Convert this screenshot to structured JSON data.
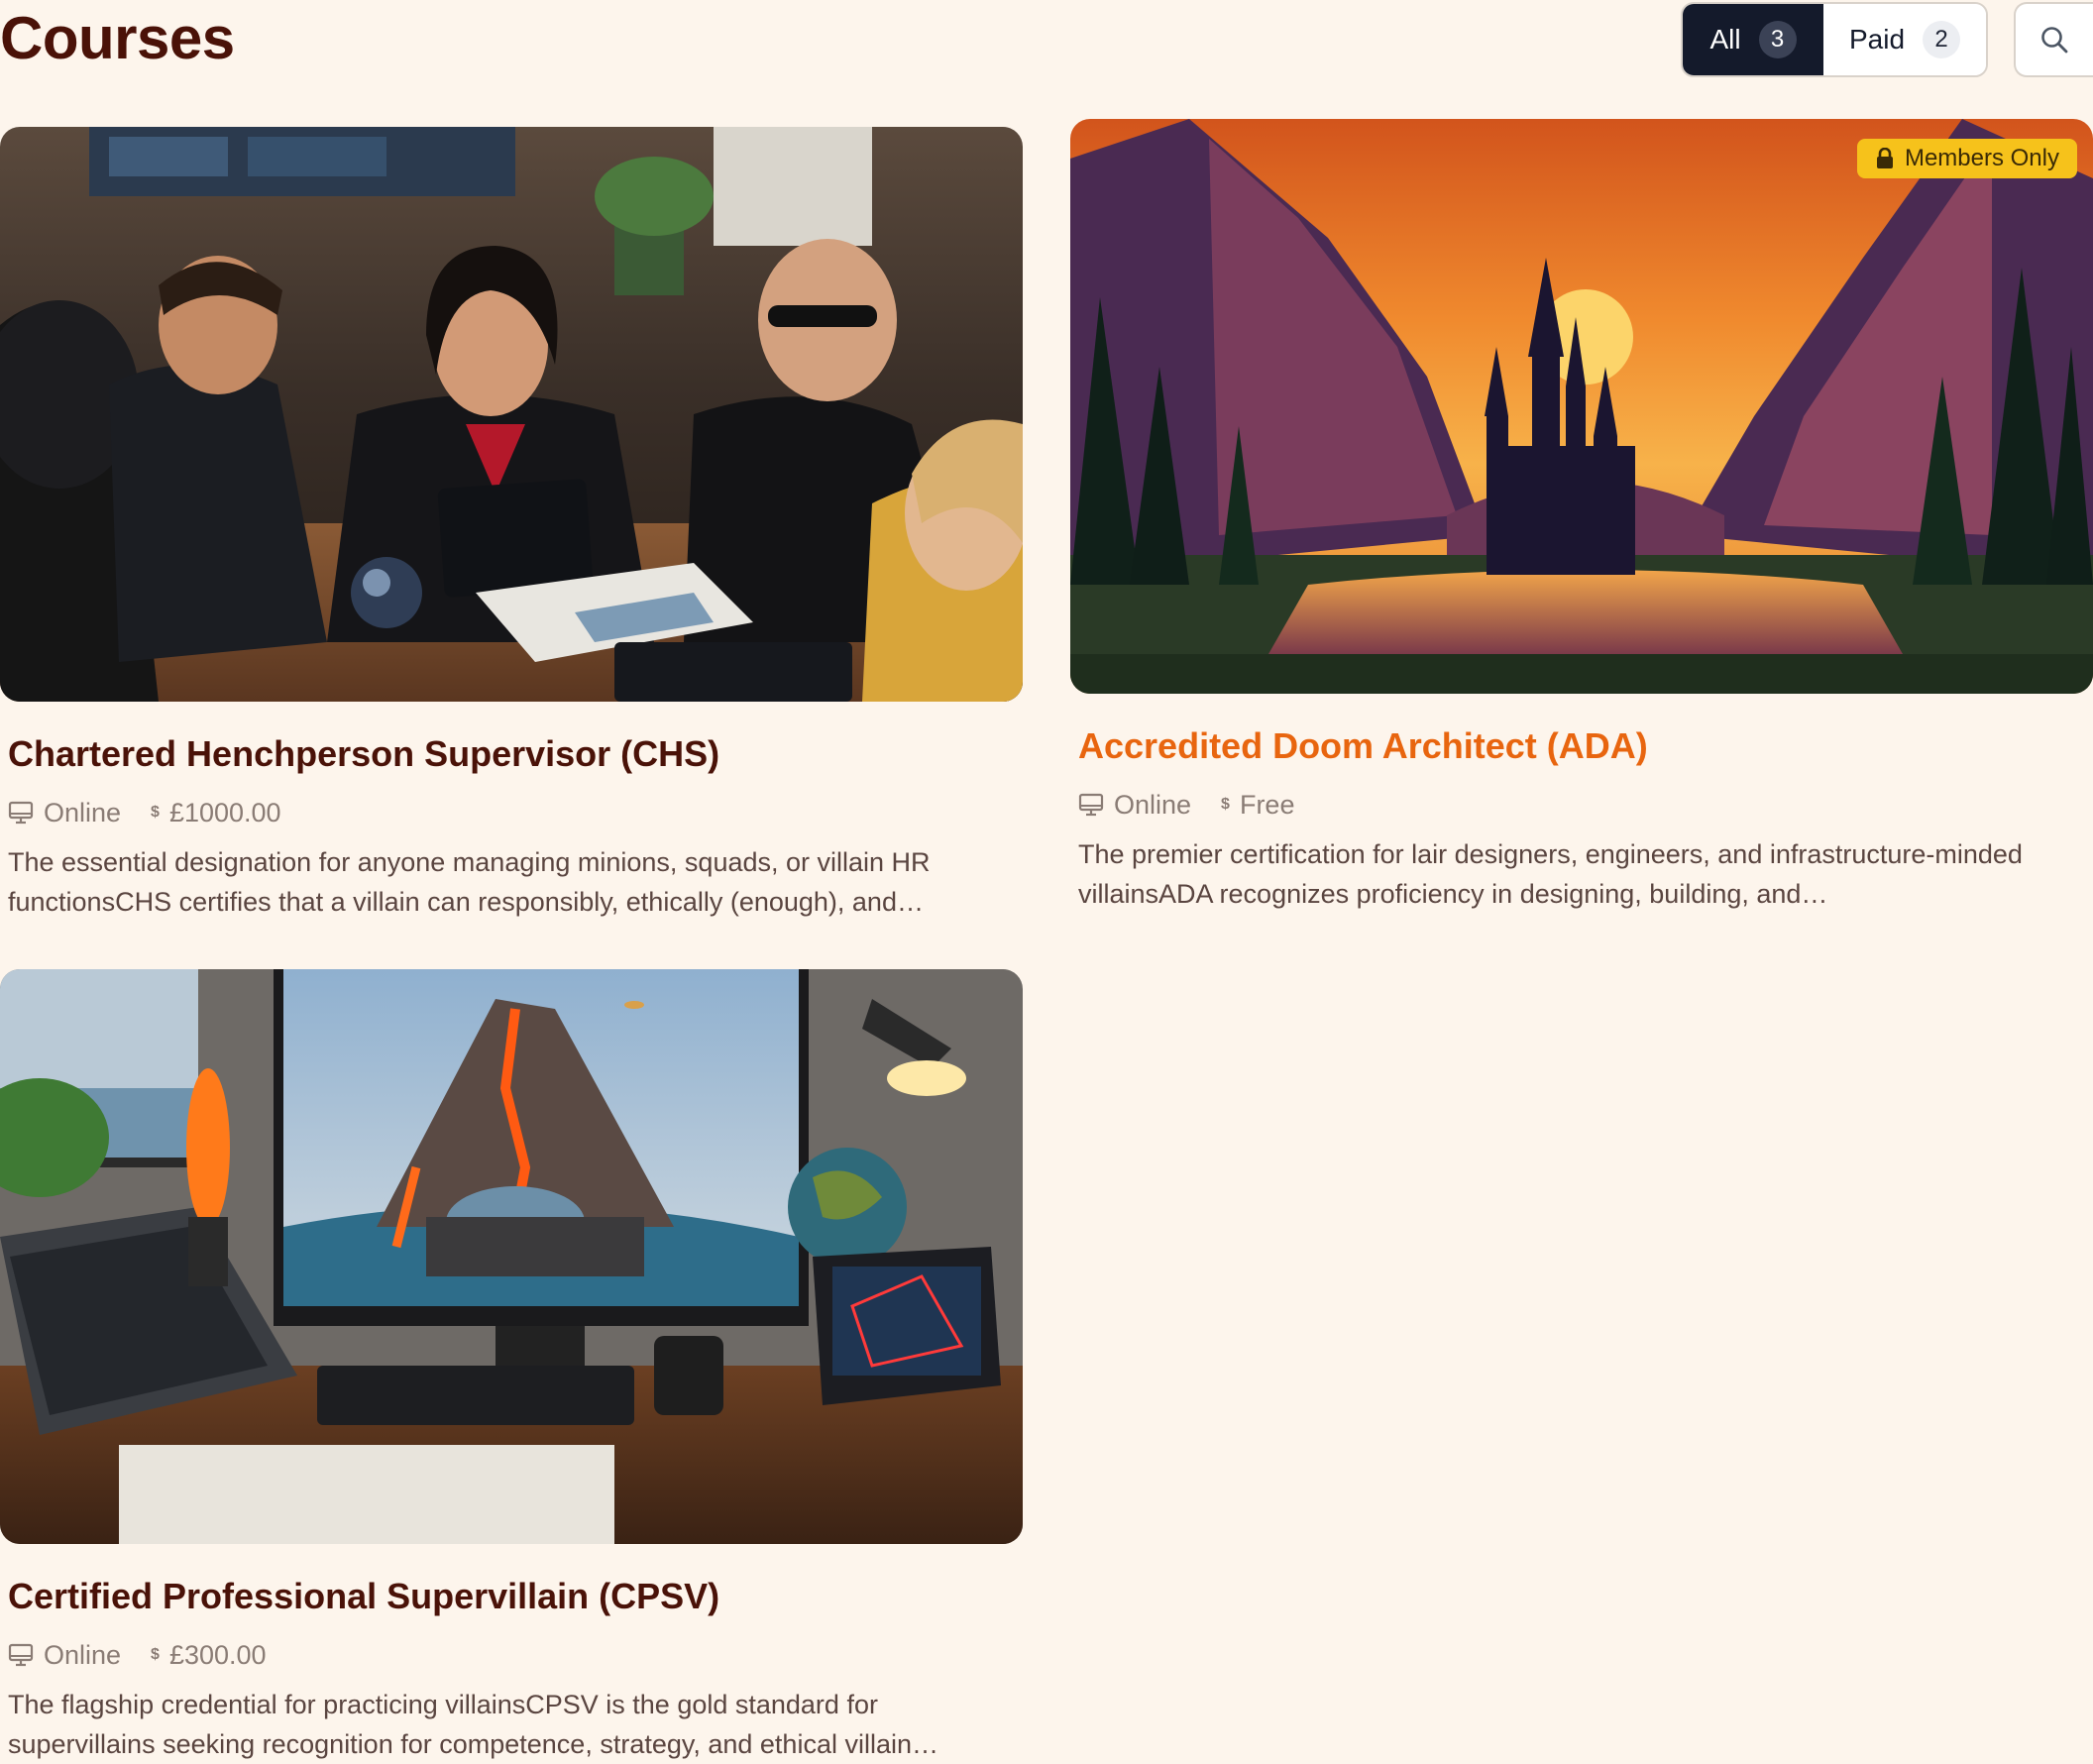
{
  "page": {
    "title": "Courses"
  },
  "filters": {
    "all_label": "All",
    "all_count": "3",
    "paid_label": "Paid",
    "paid_count": "2"
  },
  "courses": [
    {
      "title": "Chartered Henchperson Supervisor (CHS)",
      "delivery": "Online",
      "price": "£1000.00",
      "description": "The essential designation for anyone managing minions, squads, or villain HR functionsCHS certifies that a villain can responsibly, ethically (enough), and…",
      "image": "team-meeting-photo"
    },
    {
      "title": "Accredited Doom Architect (ADA)",
      "delivery": "Online",
      "price": "Free",
      "description": "The premier certification for lair designers, engineers, and infrastructure-minded villainsADA recognizes proficiency in designing, building, and…",
      "badge": "Members Only",
      "image": "castle-sunset-illustration",
      "title_color": "#e8650f"
    },
    {
      "title": "Certified Professional Supervillain (CPSV)",
      "delivery": "Online",
      "price": "£300.00",
      "description": "The flagship credential for practicing villainsCPSV is the gold standard for supervillains seeking recognition for competence, strategy, and ethical villain…",
      "image": "volcano-lair-desk-photo"
    }
  ],
  "colors": {
    "background": "#fdf5ec",
    "title": "#4a1208",
    "accent": "#e8650f",
    "active_filter": "#141a2b",
    "badge": "#f6c21b"
  }
}
